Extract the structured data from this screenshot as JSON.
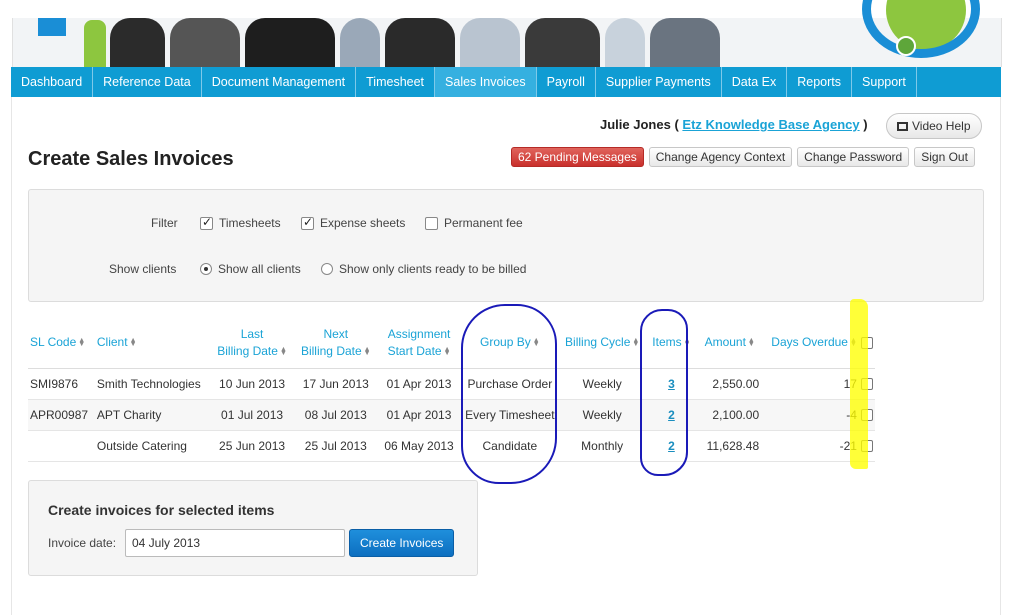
{
  "nav": [
    {
      "label": "Dashboard"
    },
    {
      "label": "Reference Data"
    },
    {
      "label": "Document Management"
    },
    {
      "label": "Timesheet"
    },
    {
      "label": "Sales Invoices"
    },
    {
      "label": "Payroll"
    },
    {
      "label": "Supplier Payments"
    },
    {
      "label": "Data Ex"
    },
    {
      "label": "Reports"
    },
    {
      "label": "Support"
    }
  ],
  "user": {
    "name": "Julie Jones",
    "open_paren": "(",
    "agency": "Etz Knowledge Base Agency",
    "close_paren": ")"
  },
  "video_help": "Video Help",
  "page_title": "Create Sales Invoices",
  "actions": {
    "pending": "62 Pending Messages",
    "change_context": "Change Agency Context",
    "change_password": "Change Password",
    "sign_out": "Sign Out"
  },
  "filter": {
    "label": "Filter",
    "timesheets": {
      "label": "Timesheets",
      "checked": true
    },
    "expense": {
      "label": "Expense sheets",
      "checked": true
    },
    "permanent": {
      "label": "Permanent fee",
      "checked": false
    }
  },
  "show_clients": {
    "label": "Show clients",
    "all": {
      "label": "Show all clients",
      "selected": true
    },
    "ready": {
      "label": "Show only clients ready to be billed",
      "selected": false
    }
  },
  "table": {
    "headers": {
      "sl_code": "SL Code",
      "client": "Client",
      "last_billing_1": "Last",
      "last_billing_2": "Billing Date",
      "next_billing_1": "Next",
      "next_billing_2": "Billing Date",
      "assignment_1": "Assignment",
      "assignment_2": "Start Date",
      "group_by": "Group By",
      "billing_cycle": "Billing Cycle",
      "items": "Items",
      "amount": "Amount",
      "days_overdue": "Days Overdue"
    },
    "rows": [
      {
        "sl_code": "SMI9876",
        "client": "Smith Technologies",
        "last": "10 Jun 2013",
        "next": "17 Jun 2013",
        "start": "01 Apr 2013",
        "group_by": "Purchase Order",
        "cycle": "Weekly",
        "items": "3",
        "amount": "2,550.00",
        "overdue": "17"
      },
      {
        "sl_code": "APR00987",
        "client": "APT Charity",
        "last": "01 Jul 2013",
        "next": "08 Jul 2013",
        "start": "01 Apr 2013",
        "group_by": "Every Timesheet",
        "cycle": "Weekly",
        "items": "2",
        "amount": "2,100.00",
        "overdue": "-4"
      },
      {
        "sl_code": "",
        "client": "Outside Catering",
        "last": "25 Jun 2013",
        "next": "25 Jul 2013",
        "start": "06 May 2013",
        "group_by": "Candidate",
        "cycle": "Monthly",
        "items": "2",
        "amount": "11,628.48",
        "overdue": "-21"
      }
    ]
  },
  "create": {
    "title": "Create invoices for selected items",
    "date_label": "Invoice date:",
    "date_value": "04 July 2013",
    "button": "Create Invoices"
  },
  "colors": {
    "nav_bg": "#0f9cd3",
    "link": "#1aa3d6",
    "danger": "#c9302c",
    "primary_button": "#0d6fc0",
    "annotation_circle": "#1a1ab8",
    "highlight": "#ffff00"
  }
}
